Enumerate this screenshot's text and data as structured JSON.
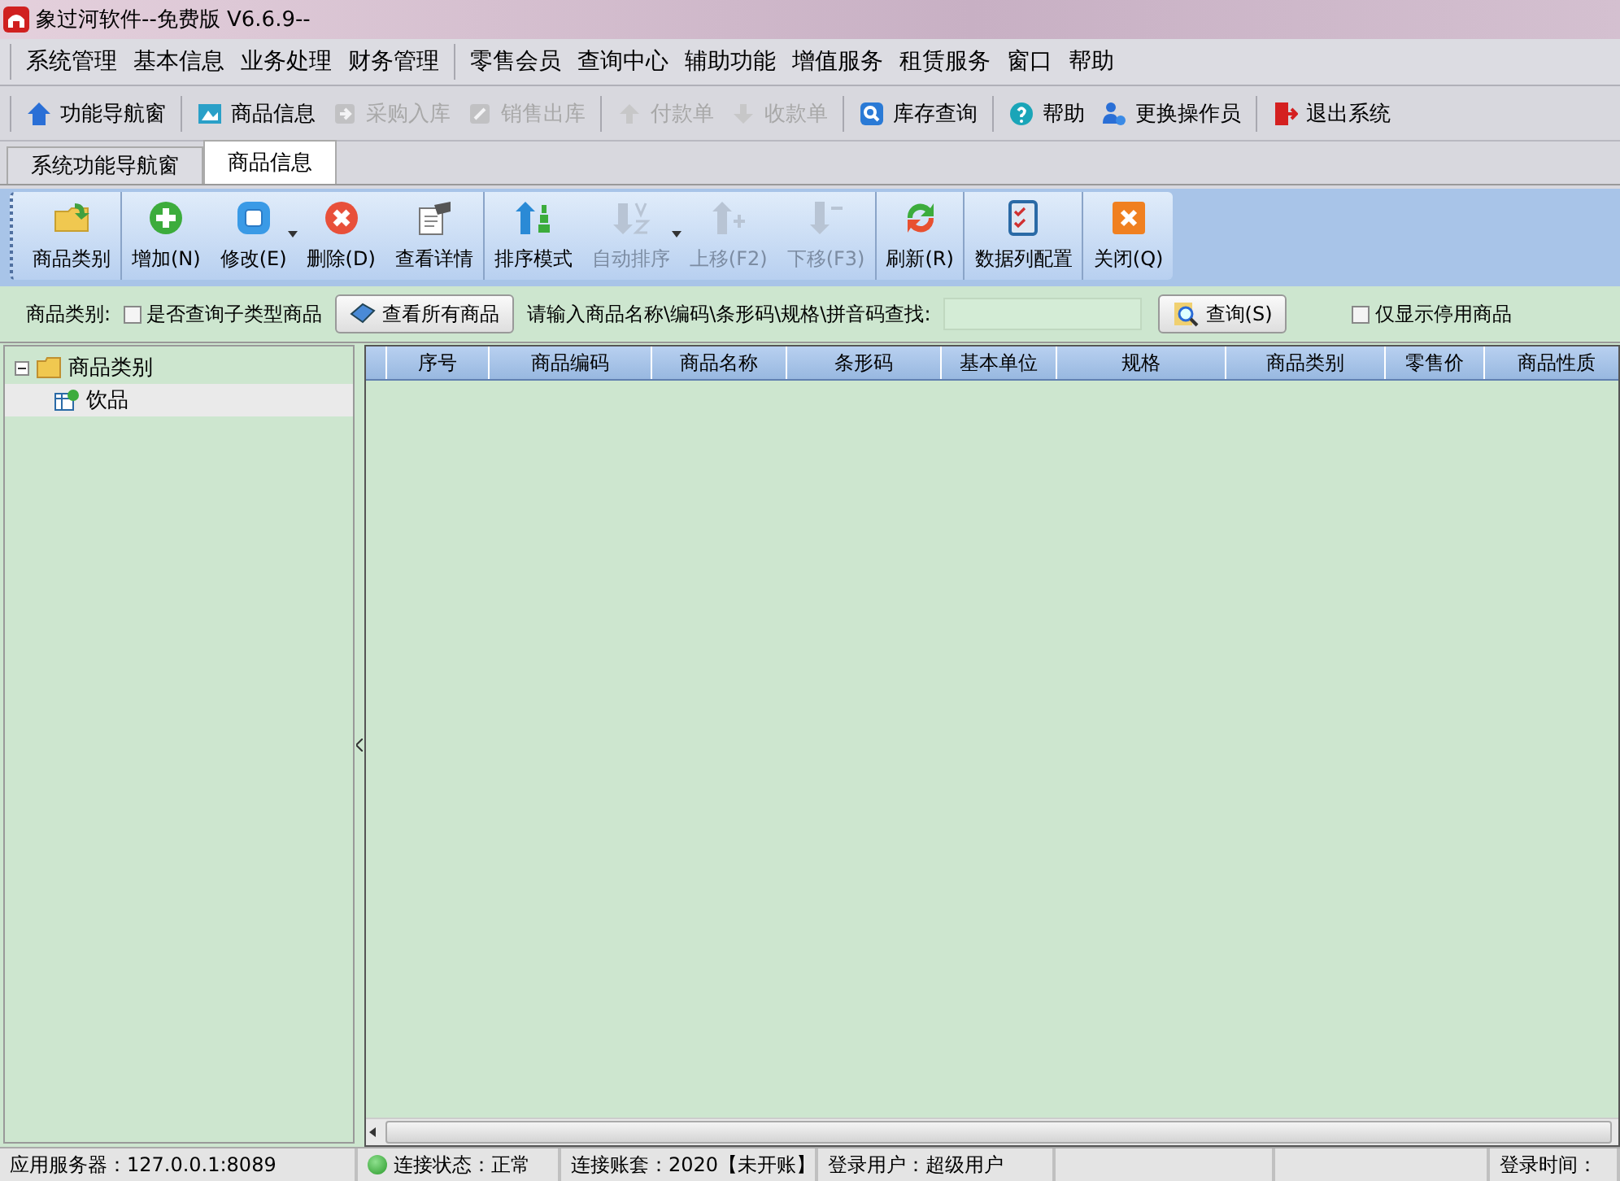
{
  "window": {
    "title": "象过河软件--免费版 V6.6.9--"
  },
  "menu": [
    [
      "系统管理",
      "基本信息",
      "业务处理",
      "财务管理"
    ],
    [
      "零售会员",
      "查询中心",
      "辅助功能",
      "增值服务",
      "租赁服务",
      "窗口",
      "帮助"
    ]
  ],
  "toolbar": [
    [
      {
        "label": "功能导航窗",
        "disabled": false
      }
    ],
    [
      {
        "label": "商品信息",
        "disabled": false
      },
      {
        "label": "采购入库",
        "disabled": true
      },
      {
        "label": "销售出库",
        "disabled": true
      }
    ],
    [
      {
        "label": "付款单",
        "disabled": true
      },
      {
        "label": "收款单",
        "disabled": true
      }
    ],
    [
      {
        "label": "库存查询",
        "disabled": false
      }
    ],
    [
      {
        "label": "帮助",
        "disabled": false
      },
      {
        "label": "更换操作员",
        "disabled": false
      }
    ],
    [
      {
        "label": "退出系统",
        "disabled": false
      }
    ]
  ],
  "tabs": [
    {
      "label": "系统功能导航窗",
      "selected": false
    },
    {
      "label": "商品信息",
      "selected": true
    }
  ],
  "ribbon": [
    [
      {
        "label": "商品类别",
        "disabled": false,
        "has_menu": false
      }
    ],
    [
      {
        "label": "增加(N)",
        "disabled": false,
        "has_menu": false
      },
      {
        "label": "修改(E)",
        "disabled": false,
        "has_menu": true
      },
      {
        "label": "删除(D)",
        "disabled": false,
        "has_menu": false
      },
      {
        "label": "查看详情",
        "disabled": false,
        "has_menu": false
      }
    ],
    [
      {
        "label": "排序模式",
        "disabled": false,
        "has_menu": false
      },
      {
        "label": "自动排序",
        "disabled": true,
        "has_menu": true
      },
      {
        "label": "上移(F2)",
        "disabled": true,
        "has_menu": false
      },
      {
        "label": "下移(F3)",
        "disabled": true,
        "has_menu": false
      }
    ],
    [
      {
        "label": "刷新(R)",
        "disabled": false,
        "has_menu": false
      }
    ],
    [
      {
        "label": "数据列配置",
        "disabled": false,
        "has_menu": false
      }
    ],
    [
      {
        "label": "关闭(Q)",
        "disabled": false,
        "has_menu": false
      }
    ]
  ],
  "filter": {
    "category_label": "商品类别:",
    "subtype_checkbox": {
      "label": "是否查询子类型商品",
      "checked": false
    },
    "view_all_button": "查看所有商品",
    "search_label": "请输入商品名称\\编码\\条形码\\规格\\拼音码查找:",
    "search_button": "查询(S)",
    "disabled_only_checkbox": {
      "label": "仅显示停用商品",
      "checked": false
    }
  },
  "tree": [
    {
      "label": "商品类别",
      "expanded": true,
      "selected": false,
      "children": [
        {
          "label": "饮品",
          "selected": true
        }
      ]
    }
  ],
  "table": {
    "columns": [
      "序号",
      "商品编码",
      "商品名称",
      "条形码",
      "基本单位",
      "规格",
      "商品类别",
      "零售价",
      "商品性质"
    ]
  },
  "status_bar": {
    "left": [
      "应用服务器：127.0.0.1:8089",
      "连接状态：正常",
      "连接账套：2020【未开账】",
      "登录用户：超级用户"
    ],
    "right": [
      "登录时间："
    ]
  }
}
